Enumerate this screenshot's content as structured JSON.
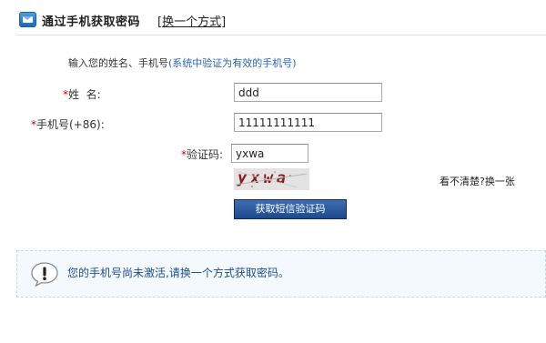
{
  "header": {
    "title": "通过手机获取密码",
    "switch_open": "[",
    "switch_label": "换一个方式",
    "switch_close": "]"
  },
  "instruction": {
    "text": "输入您的姓名、手机号",
    "hint": "(系统中验证为有效的手机号)"
  },
  "form": {
    "name": {
      "required_mark": "*",
      "label": "姓  名:",
      "value": "ddd"
    },
    "phone": {
      "required_mark": "*",
      "label": "手机号(+86):",
      "value": "11111111111"
    },
    "captcha": {
      "required_mark": "*",
      "label": "验证码:",
      "value": "yxwa",
      "image_text": "yxwa"
    },
    "refresh_label": "看不清楚?换一张",
    "sms_button": "获取短信验证码"
  },
  "notice": {
    "icon": "exclamation-icon",
    "text": "您的手机号尚未激活,请换一个方式获取密码。"
  }
}
